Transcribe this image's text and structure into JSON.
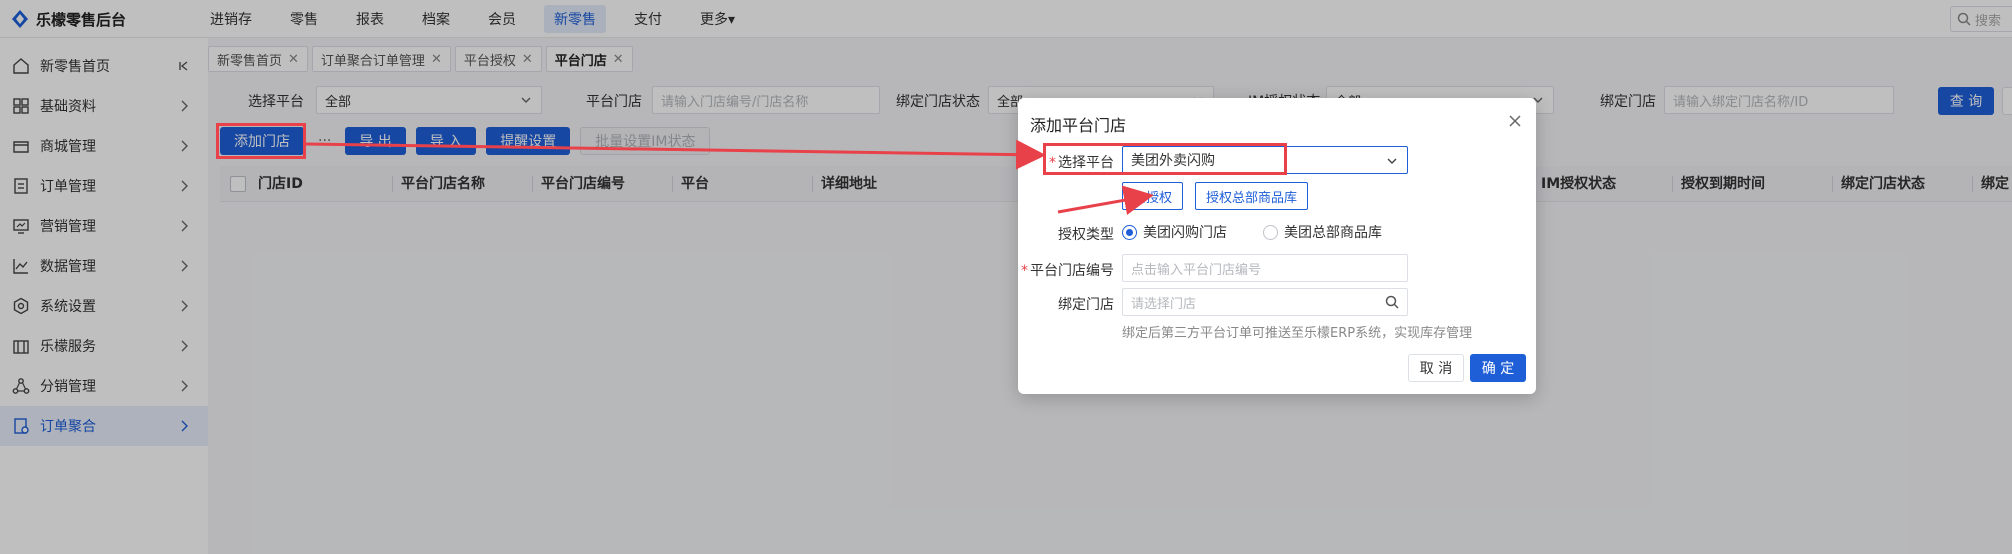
{
  "app": {
    "title": "乐檬零售后台"
  },
  "topnav": [
    {
      "label": "进销存",
      "active": false
    },
    {
      "label": "零售",
      "active": false
    },
    {
      "label": "报表",
      "active": false
    },
    {
      "label": "档案",
      "active": false
    },
    {
      "label": "会员",
      "active": false
    },
    {
      "label": "新零售",
      "active": true
    },
    {
      "label": "支付",
      "active": false
    },
    {
      "label": "更多▾",
      "active": false
    }
  ],
  "top_search": {
    "placeholder": "搜索"
  },
  "sidebar": {
    "items": [
      {
        "label": "新零售首页",
        "icon": "home-icon",
        "active": false
      },
      {
        "label": "基础资料",
        "icon": "grid-icon",
        "active": false
      },
      {
        "label": "商城管理",
        "icon": "store-icon",
        "active": false
      },
      {
        "label": "订单管理",
        "icon": "document-icon",
        "active": false
      },
      {
        "label": "营销管理",
        "icon": "monitor-icon",
        "active": false
      },
      {
        "label": "数据管理",
        "icon": "chart-icon",
        "active": false
      },
      {
        "label": "系统设置",
        "icon": "gear-icon",
        "active": false
      },
      {
        "label": "乐檬服务",
        "icon": "building-icon",
        "active": false
      },
      {
        "label": "分销管理",
        "icon": "network-icon",
        "active": false
      },
      {
        "label": "订单聚合",
        "icon": "order-aggregate-icon",
        "active": true
      }
    ]
  },
  "tabs": [
    {
      "label": "新零售首页",
      "active": false
    },
    {
      "label": "订单聚合订单管理",
      "active": false
    },
    {
      "label": "平台授权",
      "active": false
    },
    {
      "label": "平台门店",
      "active": true
    }
  ],
  "filters": {
    "platform_label": "选择平台",
    "platform_value": "全部",
    "store_label": "平台门店",
    "store_placeholder": "请输入门店编号/门店名称",
    "bind_status_label": "绑定门店状态",
    "bind_status_value": "全部",
    "im_status_label": "IM授权状态",
    "im_status_value": "全部",
    "bind_store_label": "绑定门店",
    "bind_store_placeholder": "请输入绑定门店名称/ID",
    "query_label": "查 询"
  },
  "actions": {
    "add_store": "添加门店",
    "more": "···",
    "export": "导 出",
    "import": "导 入",
    "remind": "提醒设置",
    "batch_im": "批量设置IM状态"
  },
  "table": {
    "columns": [
      "门店ID",
      "平台门店名称",
      "平台门店编号",
      "平台",
      "详细地址",
      "IM授权状态",
      "授权到期时间",
      "绑定门店状态",
      "绑定"
    ]
  },
  "modal": {
    "title": "添加平台门店",
    "platform_label": "选择平台",
    "platform_value": "美团外卖闪购",
    "btn_authorize": "去授权",
    "btn_authorize_hq": "授权总部商品库",
    "auth_type_label": "授权类型",
    "auth_type_options": [
      {
        "label": "美团闪购门店",
        "checked": true
      },
      {
        "label": "美团总部商品库",
        "checked": false
      }
    ],
    "store_no_label": "平台门店编号",
    "store_no_placeholder": "点击输入平台门店编号",
    "bind_store_label": "绑定门店",
    "bind_store_placeholder": "请选择门店",
    "hint": "绑定后第三方平台订单可推送至乐檬ERP系统，实现库存管理",
    "cancel": "取 消",
    "ok": "确 定"
  },
  "colors": {
    "primary": "#1e5fd8",
    "annotation": "#e8414a"
  }
}
